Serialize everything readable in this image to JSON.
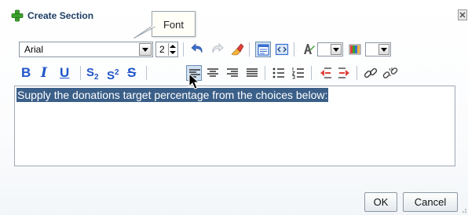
{
  "dialog": {
    "title": "Create Section",
    "close_icon": "close-x-icon",
    "add_icon": "green-plus-icon"
  },
  "tooltip": {
    "text": "Font"
  },
  "toolbar1": {
    "font_family": "Arial",
    "font_size": "2",
    "buttons": [
      "undo-icon",
      "redo-icon",
      "clear-formatting-icon",
      "wysiwyg-mode-icon",
      "source-mode-icon",
      "text-color-icon",
      "background-color-icon"
    ]
  },
  "toolbar2": {
    "bold": "B",
    "italic": "I",
    "underline": "U",
    "subscript": "S",
    "subscript_mark": "2",
    "superscript": "S",
    "superscript_mark": "2",
    "strikethrough": "S",
    "buttons": [
      "align-left-icon",
      "align-center-icon",
      "align-right-icon",
      "justify-icon",
      "bullet-list-icon",
      "numbered-list-icon",
      "outdent-icon",
      "indent-icon",
      "link-icon",
      "unlink-icon"
    ]
  },
  "editor": {
    "text": "Supply the donations target percentage from the choices below:"
  },
  "footer": {
    "ok_label": "OK",
    "cancel_label": "Cancel"
  },
  "colors": {
    "accent_blue": "#1f56c9",
    "selection": "#3a5f88",
    "title_text": "#1c3d63",
    "plus_green": "#3aa02a"
  }
}
